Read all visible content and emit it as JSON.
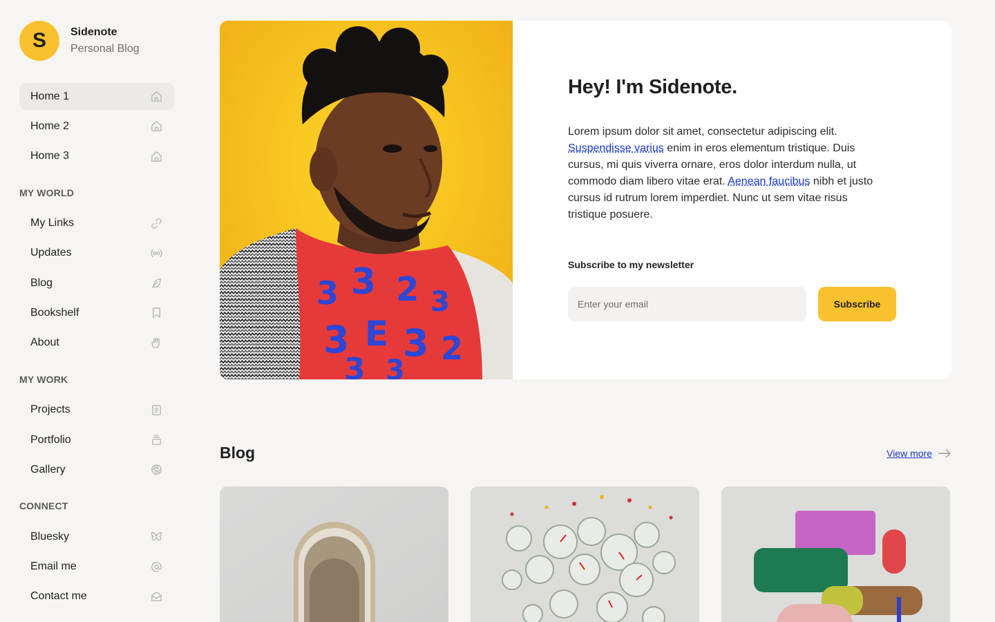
{
  "brand": {
    "initial": "S",
    "name": "Sidenote",
    "subtitle": "Personal Blog"
  },
  "nav": {
    "home": [
      {
        "label": "Home 1",
        "icon": "home-icon",
        "active": true
      },
      {
        "label": "Home 2",
        "icon": "home-icon"
      },
      {
        "label": "Home 3",
        "icon": "home-icon"
      }
    ],
    "my_world_heading": "MY WORLD",
    "my_world": [
      {
        "label": "My Links",
        "icon": "link-icon"
      },
      {
        "label": "Updates",
        "icon": "broadcast-icon"
      },
      {
        "label": "Blog",
        "icon": "feather-icon"
      },
      {
        "label": "Bookshelf",
        "icon": "bookmark-icon"
      },
      {
        "label": "About",
        "icon": "hand-wave-icon"
      }
    ],
    "my_work_heading": "MY WORK",
    "my_work": [
      {
        "label": "Projects",
        "icon": "document-icon"
      },
      {
        "label": "Portfolio",
        "icon": "stack-icon"
      },
      {
        "label": "Gallery",
        "icon": "aperture-icon"
      }
    ],
    "connect_heading": "CONNECT",
    "connect": [
      {
        "label": "Bluesky",
        "icon": "butterfly-icon"
      },
      {
        "label": "Email me",
        "icon": "at-icon"
      },
      {
        "label": "Contact me",
        "icon": "envelope-open-icon"
      }
    ]
  },
  "hero": {
    "title": "Hey! I'm Sidenote.",
    "body_1": "Lorem ipsum dolor sit amet, consectetur adipiscing elit. ",
    "link_1": "Suspendisse varius",
    "body_2": " enim in eros elementum tristique. Duis cursus, mi quis viverra ornare, eros dolor interdum nulla, ut commodo diam libero vitae erat. ",
    "link_2": "Aenean faucibus",
    "body_3": " nibh et justo cursus id rutrum lorem imperdiet. Nunc ut sem vitae risus tristique posuere.",
    "newsletter_label": "Subscribe to my newsletter",
    "email_placeholder": "Enter your email",
    "subscribe_label": "Subscribe"
  },
  "blog": {
    "title": "Blog",
    "view_more": "View more"
  },
  "colors": {
    "accent": "#f8c12d",
    "link": "#1636c9",
    "background": "#f6f5f3"
  }
}
